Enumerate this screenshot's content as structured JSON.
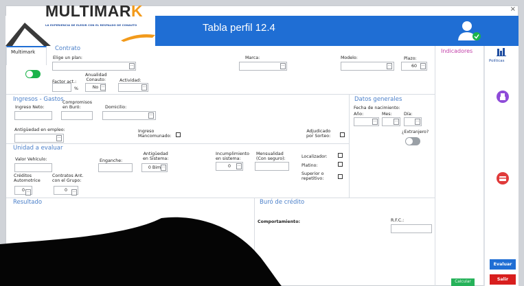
{
  "window": {
    "title": "Tabla perfil 12.4",
    "close_glyph": "×"
  },
  "logo": {
    "brand_a": "MULTIMAR",
    "brand_b": "K",
    "tagline": "LA EXPERIENCIA DE ELEGIR CON EL RESPALDO DE CONAUTO"
  },
  "tabs": {
    "multimark": "Multimark"
  },
  "contrato": {
    "title": "Contrato",
    "plan_label": "Elige un plan:",
    "marca_label": "Marca:",
    "modelo_label": "Modelo:",
    "plazo_label": "Plazo:",
    "plazo_value": "60",
    "factor_label": "Factor act.:",
    "factor_unit": "%",
    "anualidad_label": "Anualidad\nConauto:",
    "anualidad_value": "No",
    "actividad_label": "Actividad:"
  },
  "ingresos": {
    "title": "Ingresos - Gastos",
    "ingreso_neto": "Ingreso Neto:",
    "compromisos": "Compromisos\nen Buró:",
    "domicilio": "Domicilio:",
    "antiguedad_empleo": "Antigüedad en empleo:",
    "ingreso_mancomunado": "Ingreso\nMancomunado:",
    "adjudicado": "Adjudicado\npor Sorteo:"
  },
  "datos_generales": {
    "title": "Datos generales",
    "fecha_label": "Fecha de nacimiento:",
    "anio": "Año:",
    "mes": "Mes:",
    "dia": "Día:",
    "extranjero": "¿Extranjero?"
  },
  "unidad": {
    "title": "Unidad a evaluar",
    "valor_vehiculo": "Valor Vehículo:",
    "enganche": "Enganche:",
    "antiguedad_sistema": "Antigüedad\nen Sistema:",
    "antiguedad_value": "0 Bim",
    "incumplimiento": "Incumplimiento\nen sistema:",
    "incumplimiento_value": "0",
    "mensualidad": "Mensualidad\n(Con seguro):",
    "localizador": "Localizador:",
    "platino": "Platino:",
    "superior": "Superior o\nrepetitivo:",
    "creditos": "Créditos\nAutomotrice",
    "creditos_value": "0",
    "contratos": "Contratos Ant.\ncon el Grupo:",
    "contratos_value": "0"
  },
  "resultado": {
    "title": "Resultado"
  },
  "buro": {
    "title": "Buró de crédito",
    "comportamiento": "Comportamiento:",
    "rfc": "R.F.C.:"
  },
  "indicadores": {
    "title": "Indicadores",
    "calcular": "Calcular"
  },
  "sidebar": {
    "politicas": "Políticas",
    "evaluar": "Evaluar",
    "salir": "Salir"
  },
  "colors": {
    "header": "#1f6ed4",
    "accent_green": "#1bb34a",
    "section_blue": "#4a7fc9",
    "purple": "#8e4bd8",
    "red": "#e03a3a",
    "evaluar": "#1f6ed4",
    "salir": "#d81e1e"
  }
}
